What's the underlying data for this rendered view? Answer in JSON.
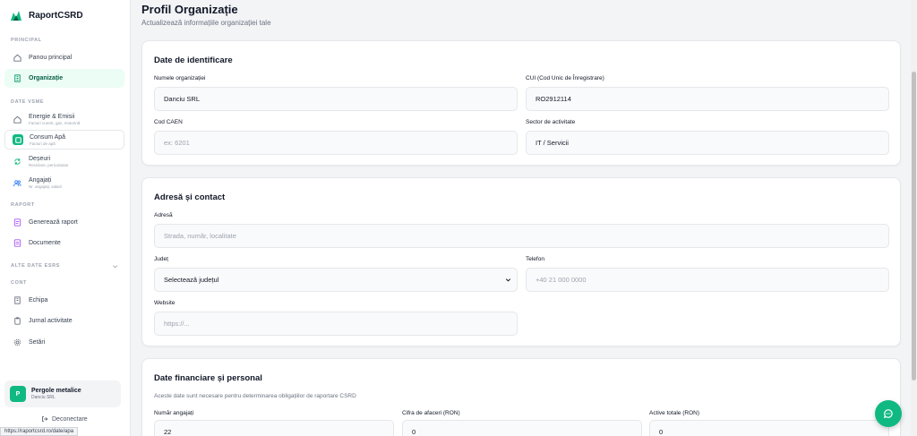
{
  "app": {
    "name": "RaportCSRD"
  },
  "sidebar": {
    "sections": {
      "principal": "PRINCIPAL",
      "date_vsme": "DATE VSME",
      "raport": "RAPORT",
      "alte_date": "ALTE DATE ESRS",
      "cont": "CONT"
    },
    "items": {
      "panou": {
        "label": "Panou principal"
      },
      "organizatie": {
        "label": "Organizație"
      },
      "energie": {
        "label": "Energie & Emisii",
        "sub": "Facturi curent, gaz, motorină"
      },
      "apa": {
        "label": "Consum Apă",
        "sub": "Facturi de apă"
      },
      "deseuri": {
        "label": "Deșeuri",
        "sub": "Reciclare, periculoase"
      },
      "angajati": {
        "label": "Angajați",
        "sub": "Nr. angajați, salarii"
      },
      "genereaza": {
        "label": "Generează raport"
      },
      "documente": {
        "label": "Documente"
      },
      "echipa": {
        "label": "Echipa"
      },
      "jurnal": {
        "label": "Jurnal activitate"
      },
      "setari": {
        "label": "Setări"
      }
    },
    "org": {
      "avatar": "P",
      "name": "Pergole metalice",
      "company": "Danciu SRL"
    },
    "logout": "Deconectare"
  },
  "page": {
    "title": "Profil Organizație",
    "subtitle": "Actualizează informațiile organizației tale"
  },
  "ident": {
    "title": "Date de identificare",
    "name_label": "Numele organizației",
    "name_value": "Danciu SRL",
    "cui_label": "CUI (Cod Unic de Înregistrare)",
    "cui_value": "RO2912114",
    "caen_label": "Cod CAEN",
    "caen_placeholder": "ex: 6201",
    "sector_label": "Sector de activitate",
    "sector_value": "IT / Servicii"
  },
  "contact": {
    "title": "Adresă și contact",
    "address_label": "Adresă",
    "address_placeholder": "Strada, număr, localitate",
    "judet_label": "Județ",
    "judet_value": "Selectează județul",
    "phone_label": "Telefon",
    "phone_placeholder": "+40 21 000 0000",
    "website_label": "Website",
    "website_placeholder": "https://..."
  },
  "finance": {
    "title": "Date financiare și personal",
    "description": "Aceste date sunt necesare pentru determinarea obligațiilor de raportare CSRD",
    "employees_label": "Număr angajați",
    "employees_value": "22",
    "revenue_label": "Cifra de afaceri (RON)",
    "revenue_value": "0",
    "assets_label": "Active totale (RON)",
    "assets_value": "0"
  },
  "status_url": "https://raportcsrd.ro/date/apa",
  "colors": {
    "accent": "#10b981",
    "active_bg": "#ecfdf5"
  }
}
